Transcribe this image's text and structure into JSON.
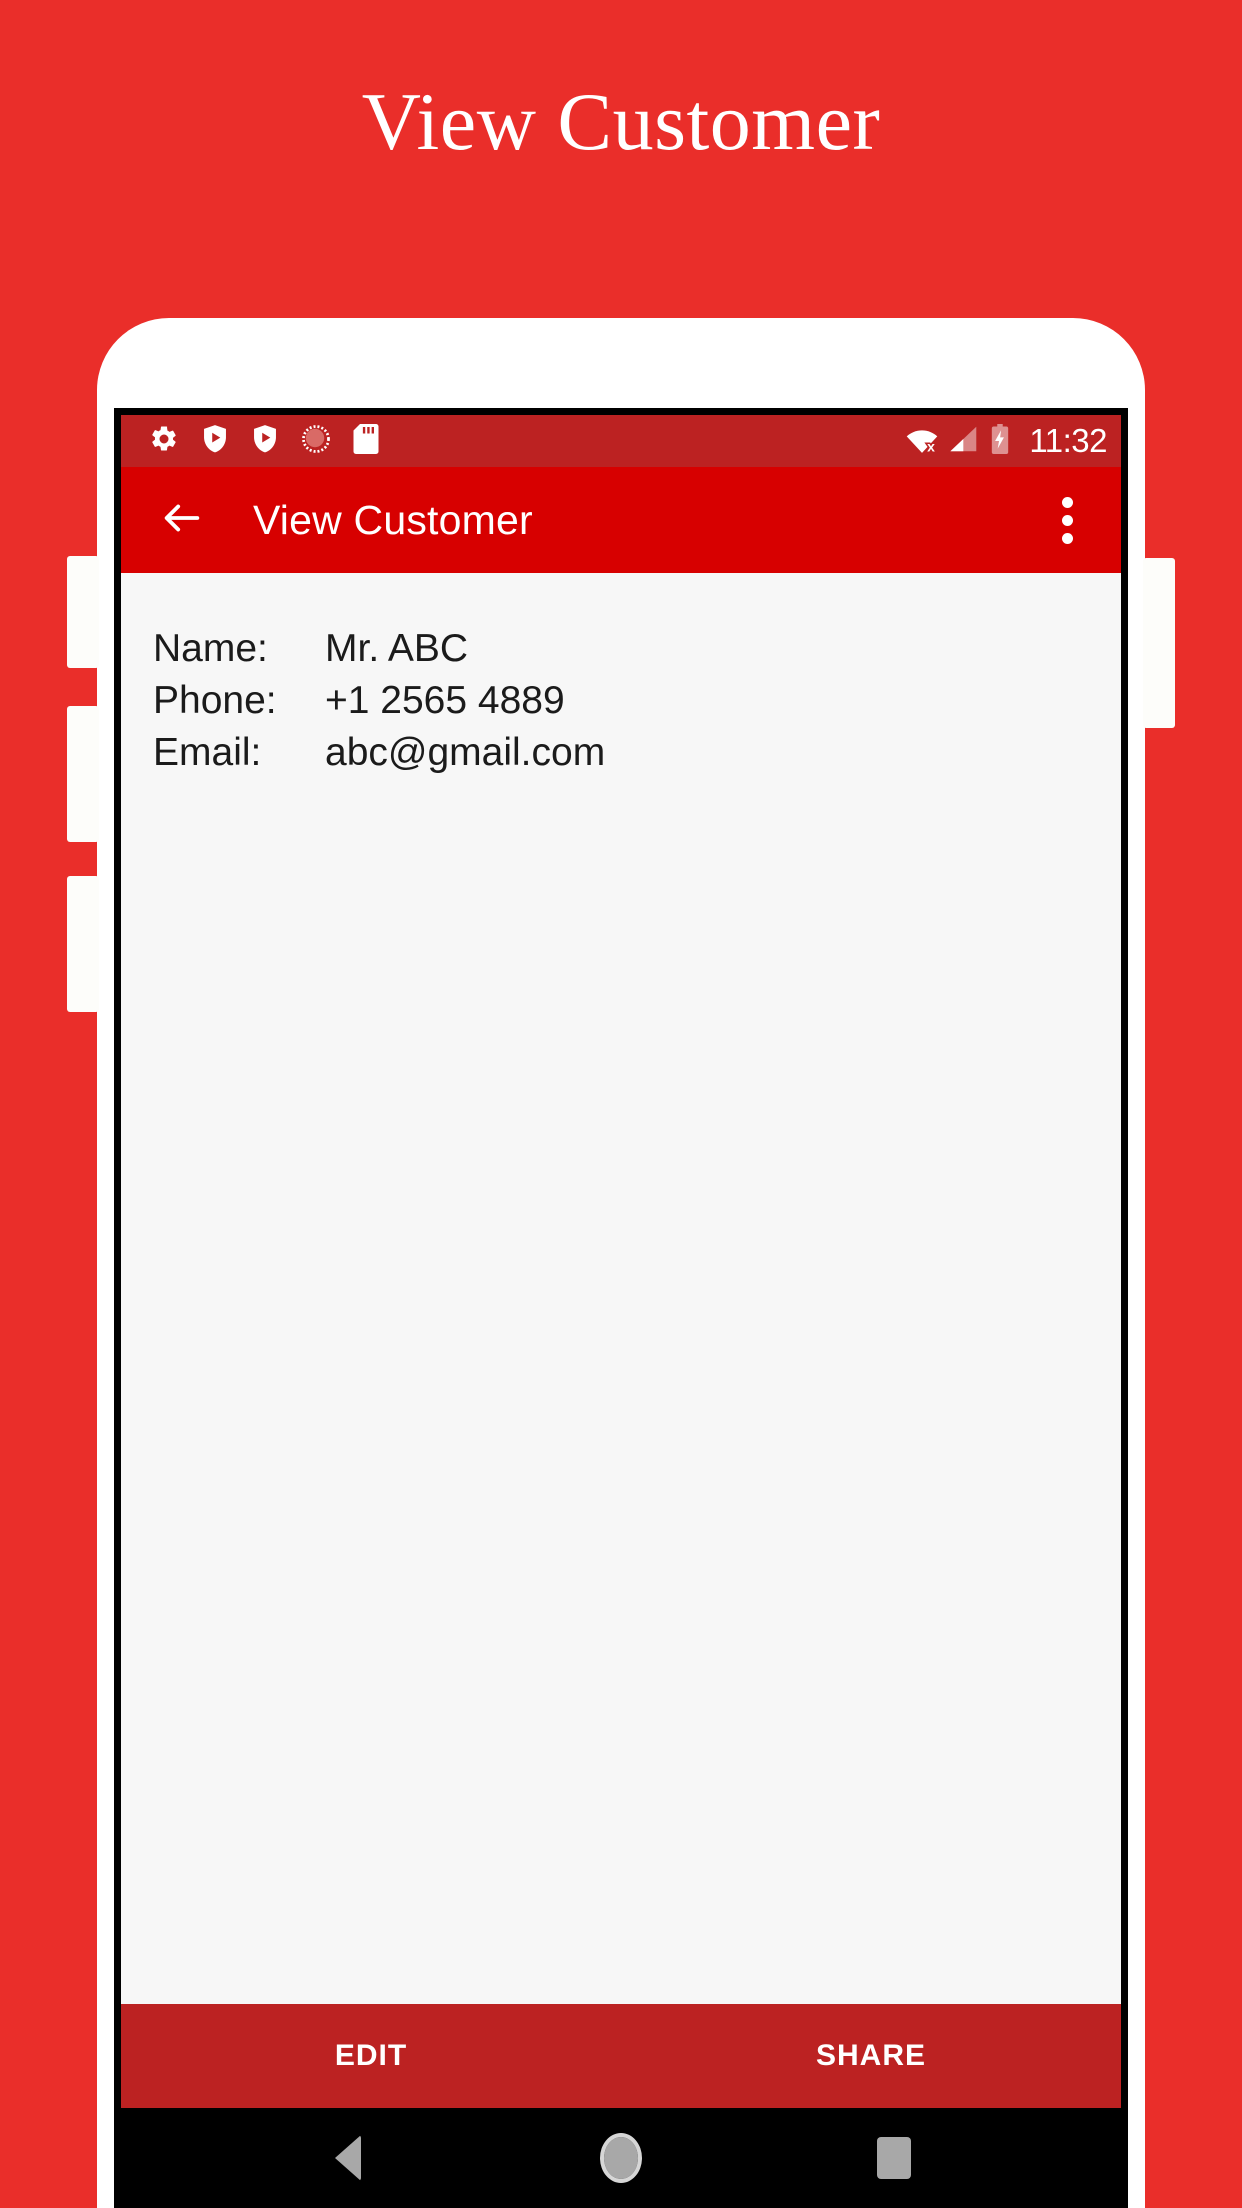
{
  "poster": {
    "title": "View Customer",
    "background_color": "#ea2e2a"
  },
  "device": {
    "frame_color": "#ffffff",
    "bezel_color": "#000000"
  },
  "status_bar": {
    "background_color": "#bc2222",
    "clock": "11:32",
    "left_icons": [
      {
        "name": "settings-gear-icon",
        "label": "Settings"
      },
      {
        "name": "shield-play-icon",
        "label": "Protected app"
      },
      {
        "name": "shield-play-icon-2",
        "label": "Protected app"
      },
      {
        "name": "sync-circle-icon",
        "label": "Syncing"
      },
      {
        "name": "sd-card-icon",
        "label": "SD card"
      }
    ],
    "right_icons": [
      {
        "name": "wifi-off-icon",
        "label": "Wi-Fi disconnected"
      },
      {
        "name": "cellular-signal-icon",
        "label": "Mobile signal"
      },
      {
        "name": "battery-charging-icon",
        "label": "Battery charging"
      }
    ]
  },
  "app_bar": {
    "background_color": "#d70000",
    "title": "View Customer",
    "back_icon": "arrow-back-icon",
    "overflow_icon": "more-vert-icon"
  },
  "content": {
    "background_color": "#f7f7f7",
    "details": [
      {
        "label": "Name:",
        "value": "Mr. ABC"
      },
      {
        "label": "Phone:",
        "value": "+1 2565 4889"
      },
      {
        "label": "Email:",
        "value": "abc@gmail.com"
      }
    ]
  },
  "action_bar": {
    "background_color": "#bc2222",
    "buttons": [
      {
        "label": "EDIT"
      },
      {
        "label": "SHARE"
      }
    ]
  },
  "nav_bar": {
    "background_color": "#000000",
    "buttons": [
      {
        "name": "nav-back-icon",
        "label": "Back"
      },
      {
        "name": "nav-home-icon",
        "label": "Home"
      },
      {
        "name": "nav-recents-icon",
        "label": "Recents"
      }
    ]
  }
}
